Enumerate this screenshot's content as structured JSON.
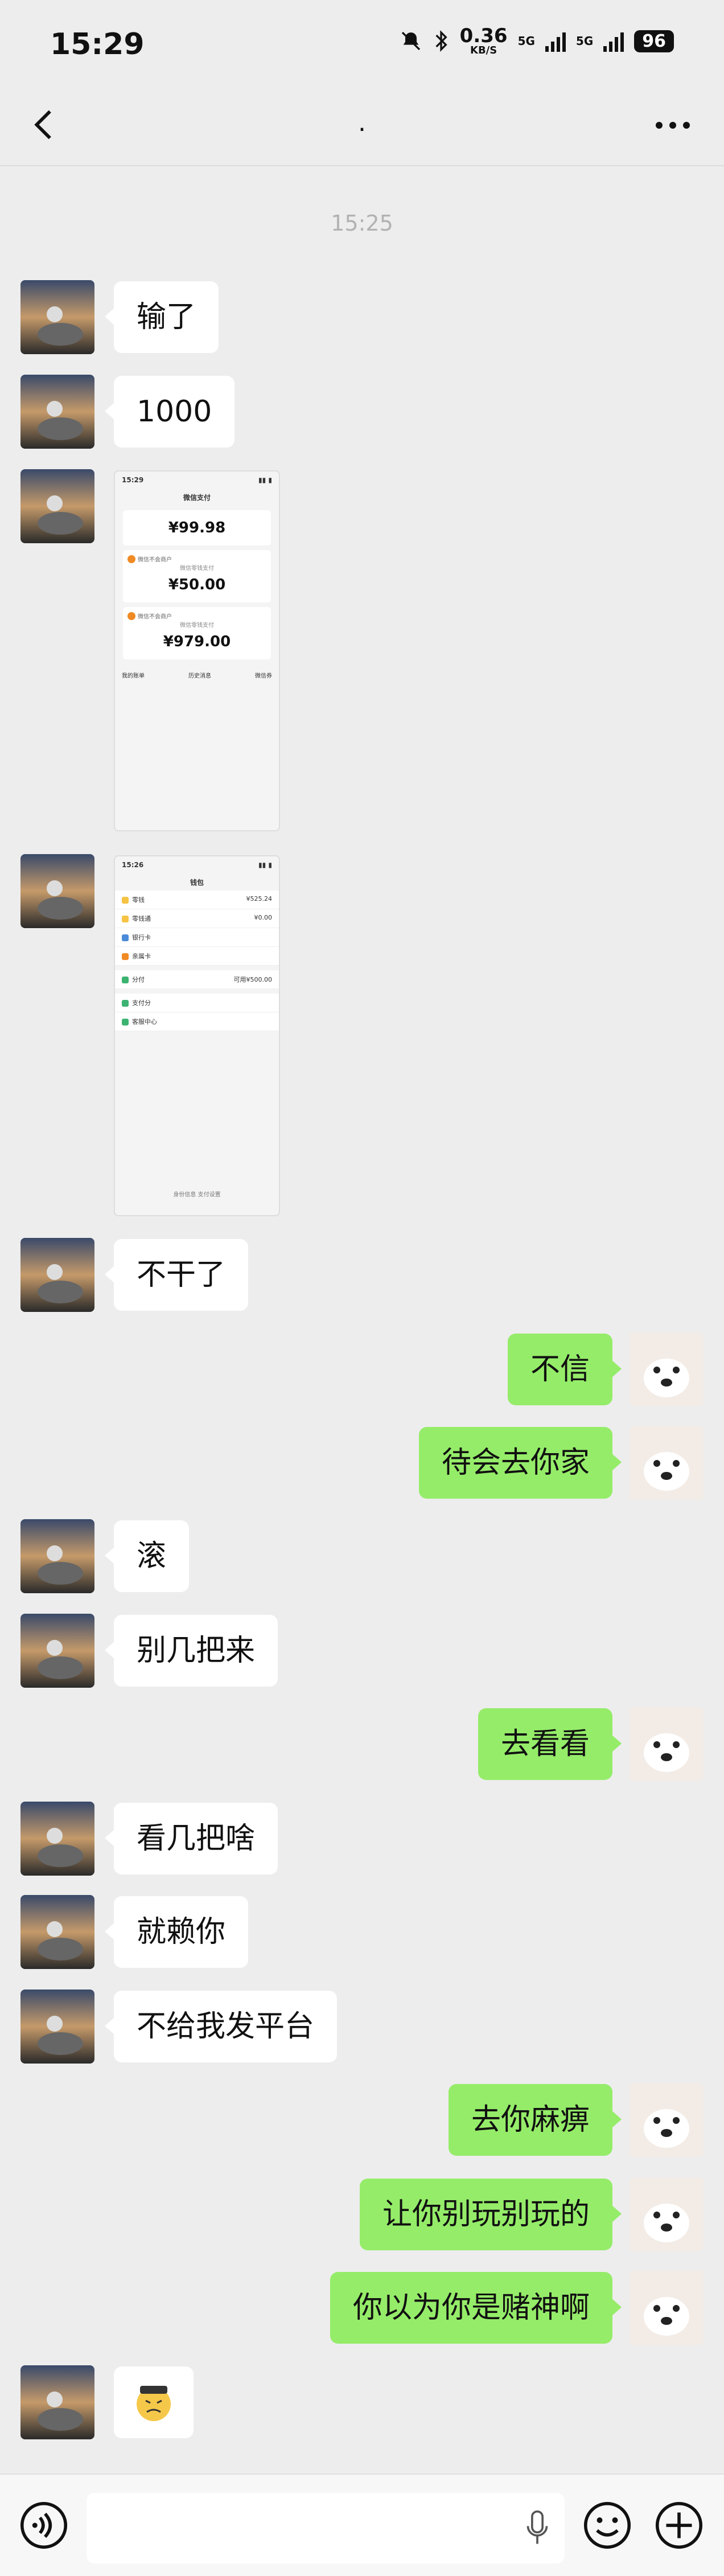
{
  "status_bar": {
    "time": "15:29",
    "net_speed": "0.36",
    "net_speed_unit": "KB/S",
    "network_1": "5G",
    "network_2": "5G",
    "battery": "96",
    "icons": [
      "mute-bell-icon",
      "bluetooth-icon",
      "signal-icon",
      "wifi-icon"
    ]
  },
  "header": {
    "title": ".",
    "back_icon": "chevron-left-icon",
    "more_icon": "more-dots-icon"
  },
  "chat": {
    "timestamp": "15:25",
    "messages": [
      {
        "side": "left",
        "text": "输了"
      },
      {
        "side": "left",
        "text": "1000"
      },
      {
        "side": "left",
        "type": "image",
        "content": "wallet-bills-screenshot"
      },
      {
        "side": "left",
        "type": "image",
        "content": "wallet-screenshot"
      },
      {
        "side": "left",
        "text": "不干了"
      },
      {
        "side": "right",
        "text": "不信"
      },
      {
        "side": "right",
        "text": "待会去你家"
      },
      {
        "side": "left",
        "text": "滚"
      },
      {
        "side": "left",
        "text": "别几把来"
      },
      {
        "side": "right",
        "text": "去看看"
      },
      {
        "side": "left",
        "text": "看几把啥"
      },
      {
        "side": "left",
        "text": "就赖你"
      },
      {
        "side": "left",
        "text": "不给我发平台"
      },
      {
        "side": "right",
        "text": "去你麻痹"
      },
      {
        "side": "right",
        "text": "让你别玩别玩的"
      },
      {
        "side": "right",
        "text": "你以为你是赌神啊"
      },
      {
        "side": "left",
        "type": "sticker",
        "content": "emoji-sticker"
      }
    ]
  },
  "screenshot1": {
    "time": "15:29",
    "title": "微信支付",
    "amount_1": "¥99.98",
    "merchant_2": "微信不会商户",
    "label_2": "微信零钱支付",
    "amount_2": "¥50.00",
    "merchant_3": "微信不会商户",
    "label_3": "微信零钱支付",
    "amount_3": "¥979.00",
    "footer": [
      "我的账单",
      "历史消息",
      "微信券"
    ]
  },
  "screenshot2": {
    "time": "15:26",
    "title": "钱包",
    "rows": [
      {
        "label": "零钱",
        "value": "¥525.24"
      },
      {
        "label": "零钱通",
        "value": "¥0.00"
      },
      {
        "label": "银行卡",
        "value": ""
      },
      {
        "label": "亲属卡",
        "value": ""
      },
      {
        "label": "分付",
        "value": "可用¥500.00"
      },
      {
        "label": "支付分",
        "value": ""
      },
      {
        "label": "客服中心",
        "value": ""
      }
    ],
    "footer": "身份信息 支付设置"
  },
  "input_bar": {
    "voice_icon": "voice-icon",
    "mic_icon": "microphone-icon",
    "emoji_icon": "emoji-icon",
    "plus_icon": "plus-icon"
  }
}
